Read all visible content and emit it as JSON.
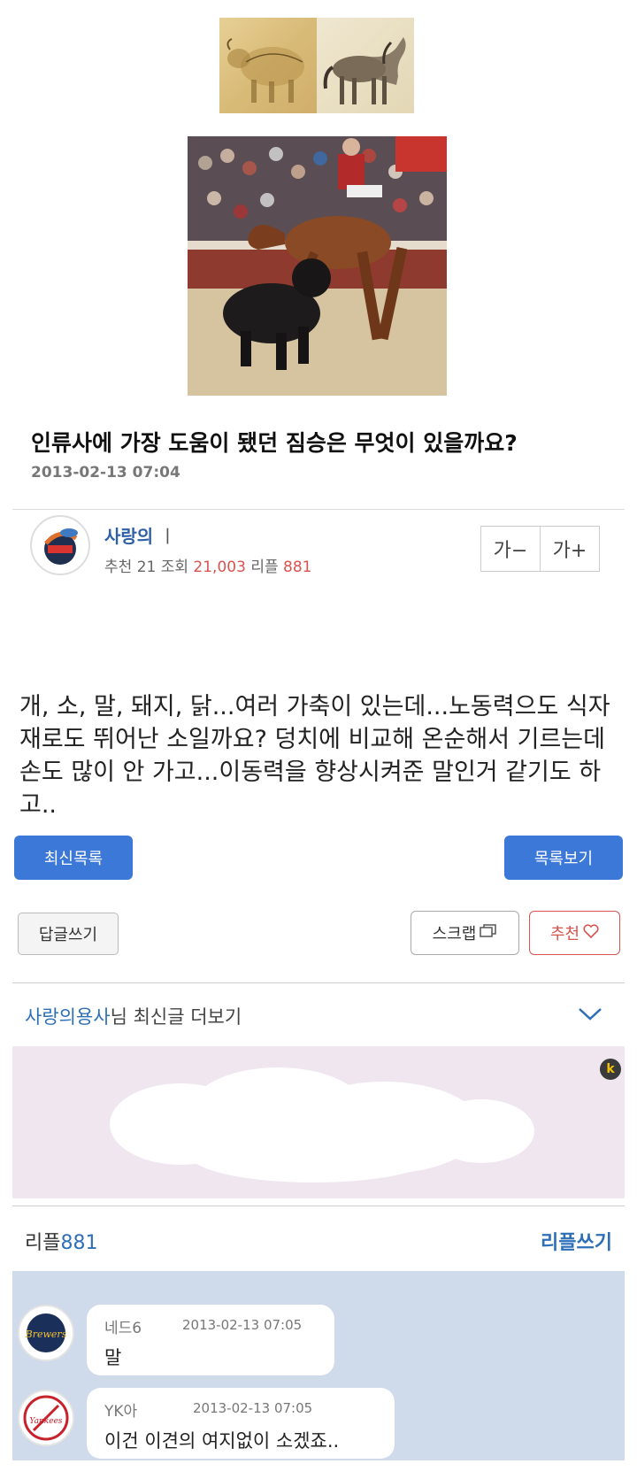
{
  "post": {
    "title": "인류사에 가장 도움이 됐던 짐승은 무엇이 있을까요?",
    "date": "2013-02-13 07:04",
    "author": "사랑의",
    "author_suffix": "ㅣ",
    "rec_label": "추천",
    "rec_count": "21",
    "views_label": "조회",
    "views_count": "21,003",
    "replies_label": "리플",
    "replies_count": "881",
    "font_decrease": "가−",
    "font_increase": "가+",
    "body": "개, 소, 말, 돼지, 닭...여러 가축이 있는데...노동력으도 식자재로도 뛰어난 소일까요? 덩치에 비교해 온순해서 기르는데 손도 많이 안 가고...이동력을 향상시켜준 말인거 같기도 하고.."
  },
  "buttons": {
    "latest_list": "최신목록",
    "view_list": "목록보기",
    "write_reply": "답글쓰기",
    "scrap": "스크랩",
    "recommend": "추천"
  },
  "more": {
    "author": "사랑의용사",
    "text": "님 최신글 더보기"
  },
  "ad": {
    "badge": "k"
  },
  "replies": {
    "label": "리플",
    "count": "881",
    "write": "리플쓰기",
    "items": [
      {
        "name": "네드6",
        "date": "2013-02-13 07:05",
        "text": "말",
        "avatar_text": "Brewers"
      },
      {
        "name": "YK아",
        "date": "2013-02-13 07:05",
        "text": "이건 이견의 여지없이 소겠죠..",
        "avatar_text": "Yankees"
      }
    ]
  },
  "colors": {
    "accent_blue": "#3b78d8",
    "link_blue": "#2f6fb8",
    "recommend_red": "#d9534f",
    "comment_bg": "#cfdaeb",
    "ad_bg": "#efe6ef"
  }
}
